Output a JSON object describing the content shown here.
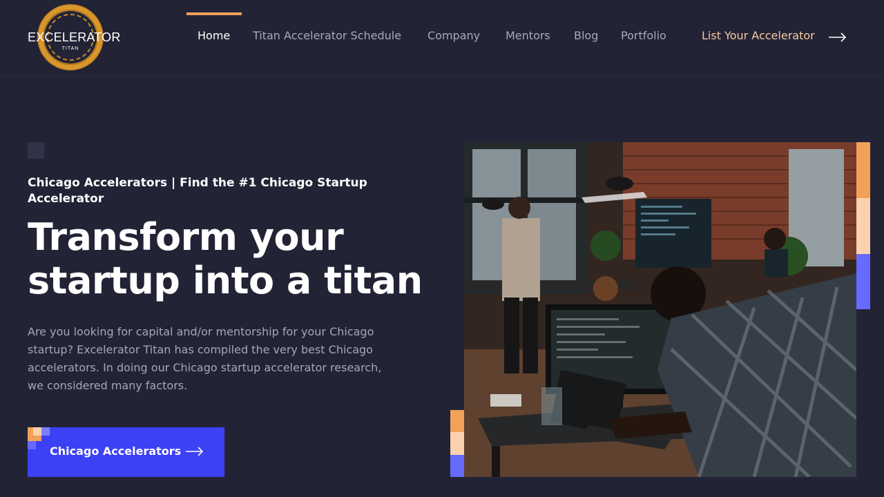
{
  "header": {
    "logo": {
      "brand": "EXCELERATOR",
      "sub": "TITAN"
    },
    "nav": [
      {
        "label": "Home",
        "active": true
      },
      {
        "label": "Titan Accelerator Schedule",
        "active": false
      },
      {
        "label": "Company",
        "active": false
      },
      {
        "label": "Mentors",
        "active": false
      },
      {
        "label": "Blog",
        "active": false
      },
      {
        "label": "Portfolio",
        "active": false
      }
    ],
    "cta": {
      "label": "List Your Accelerator",
      "icon": "arrow-right-icon"
    }
  },
  "hero": {
    "eyebrow": "Chicago Accelerators | Find the #1 Chicago Startup Accelerator",
    "headline": "Transform your startup into a titan",
    "lead": "Are you looking for capital and/or mentorship for your Chicago startup? Excelerator Titan has compiled the very best Chicago accelerators. In doing our Chicago startup accelerator research, we considered many factors.",
    "button": {
      "label": "Chicago Accelerators",
      "icon": "arrow-right-icon"
    }
  },
  "colors": {
    "background": "#232336",
    "accent_orange": "#f2a15a",
    "accent_peach": "#fcd1ae",
    "accent_blue": "#3d41f6",
    "accent_periwinkle": "#656bff",
    "logo_gold": "#d9962b"
  }
}
